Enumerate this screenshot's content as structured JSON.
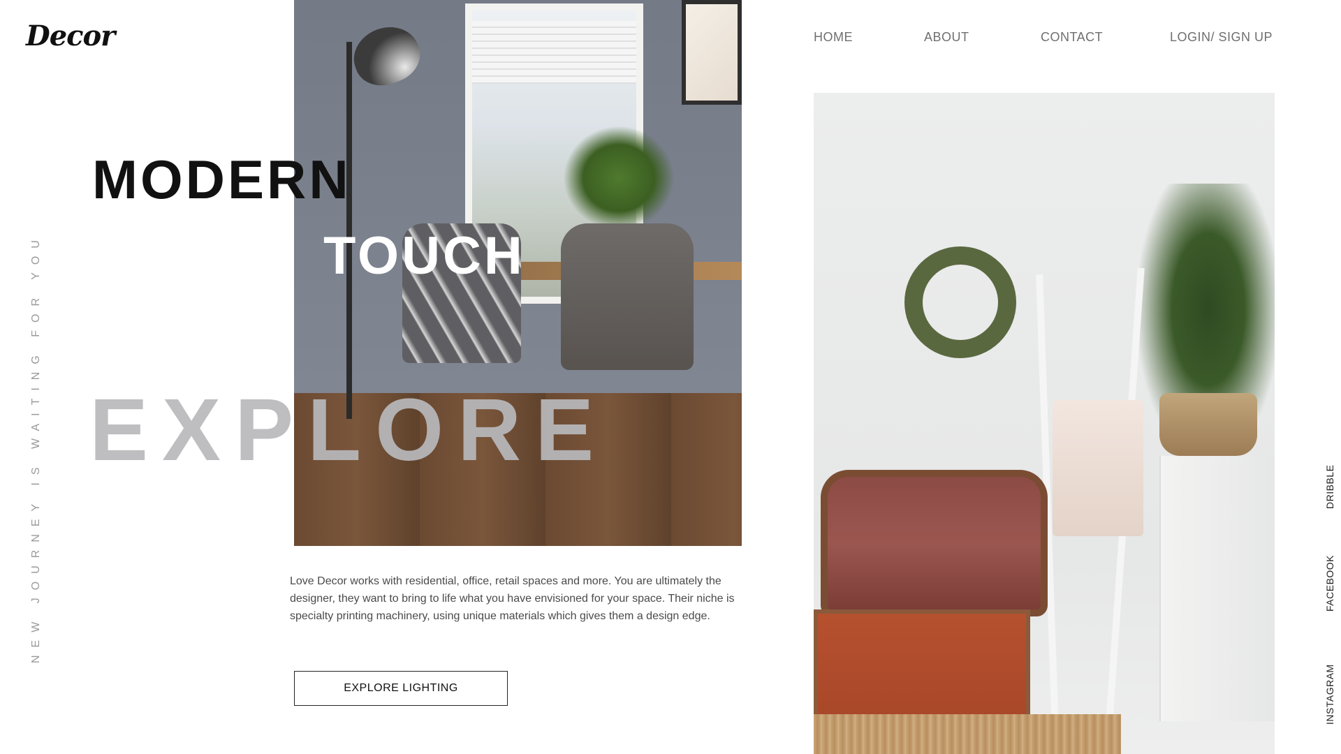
{
  "brand": {
    "logo": "Decor"
  },
  "nav": {
    "items": [
      {
        "label": "HOME"
      },
      {
        "label": "ABOUT"
      },
      {
        "label": "CONTACT"
      },
      {
        "label": "LOGIN/ SIGN UP"
      }
    ]
  },
  "hero": {
    "tagline": "NEW JOURNEY IS WAITING FOR YOU",
    "headline_line1": "MODERN",
    "headline_line2": "TOUCH",
    "headline_line3": "EXPLORE",
    "description": "Love Decor works with residential, office, retail spaces and more. You are ultimately the designer, they want to bring to life what you have envisioned for your space. Their niche is specialty printing machinery, using unique materials which gives them a design edge.",
    "cta_label": "EXPLORE LIGHTING"
  },
  "social": {
    "links": [
      {
        "label": "DRIBBLE"
      },
      {
        "label": "FACEBOOK"
      },
      {
        "label": "INSTAGRAM"
      }
    ]
  },
  "colors": {
    "text_primary": "#111111",
    "nav_text": "#6f6f6f",
    "tagline_text": "#9a9a9a",
    "explore_text": "#b9b9bc",
    "background": "#ffffff"
  },
  "icons": {
    "images": [
      "dining-room-photo",
      "living-room-photo"
    ]
  }
}
